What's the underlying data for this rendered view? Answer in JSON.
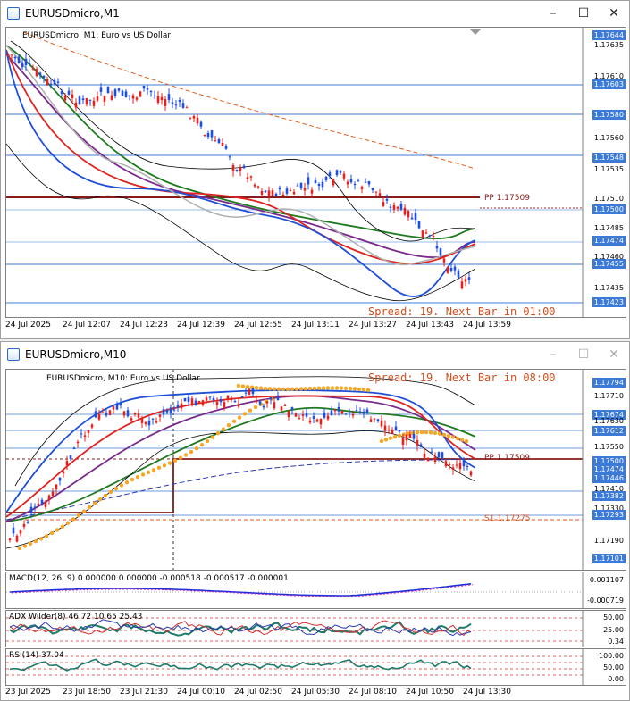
{
  "windows": [
    {
      "title": "EURUSDmicro,M1",
      "chart_label": "EURUSDmicro, M1:  Euro vs US Dollar",
      "spread_text": "Spread: 19. Next Bar in 01:00",
      "pivot_label": "PP 1.17509",
      "price_tags": [
        "1.17644",
        "1.17635",
        "1.17610",
        "1.17603",
        "1.17580",
        "1.17560",
        "1.17548",
        "1.17535",
        "1.17510",
        "1.17500",
        "1.17485",
        "1.17474",
        "1.17460",
        "1.17455",
        "1.17435",
        "1.17423"
      ],
      "time_labels": [
        "24 Jul 2025",
        "24 Jul 12:07",
        "24 Jul 12:23",
        "24 Jul 12:39",
        "24 Jul 12:55",
        "24 Jul 13:11",
        "24 Jul 13:27",
        "24 Jul 13:43",
        "24 Jul 13:59"
      ]
    },
    {
      "title": "EURUSDmicro,M10",
      "chart_label": "EURUSDmicro, M10:  Euro vs US Dollar",
      "spread_text": "Spread: 19. Next Bar in 08:00",
      "pivot_label": "PP 1.17509",
      "s1_label": "S1 1.17275",
      "price_tags": [
        "1.17794",
        "1.17710",
        "1.17674",
        "1.17630",
        "1.17612",
        "1.17550",
        "1.17500",
        "1.17474",
        "1.17446",
        "1.17410",
        "1.17382",
        "1.17330",
        "1.17293",
        "1.17190",
        "1.17101"
      ],
      "macd_label": "MACD(12, 26, 9) 0.000000 0.000000 -0.000518 -0.000517 -0.000001",
      "macd_scale": [
        "0.001107",
        "-0.000719"
      ],
      "adx_label": "ADX Wilder(8) 46.72 10.65 25.43",
      "adx_scale": [
        "50.00",
        "25.00",
        "0.34"
      ],
      "rsi_label": "RSI(14) 37.04",
      "rsi_scale": [
        "100.00",
        "50.00",
        "0.00"
      ],
      "time_labels": [
        "23 Jul 2025",
        "23 Jul 18:50",
        "23 Jul 21:30",
        "24 Jul 00:10",
        "24 Jul 02:50",
        "24 Jul 05:30",
        "24 Jul 08:10",
        "24 Jul 10:50",
        "24 Jul 13:30"
      ]
    }
  ],
  "colors": {
    "bull": "#1f4fd8",
    "bear": "#e0231e",
    "pivot": "#8b1a1a",
    "s1": "#e05020",
    "tagblue": "#3c7ad8",
    "ma_green": "#1f7a1f",
    "ma_purple": "#7a2a8a",
    "psar": "#f5a623"
  }
}
